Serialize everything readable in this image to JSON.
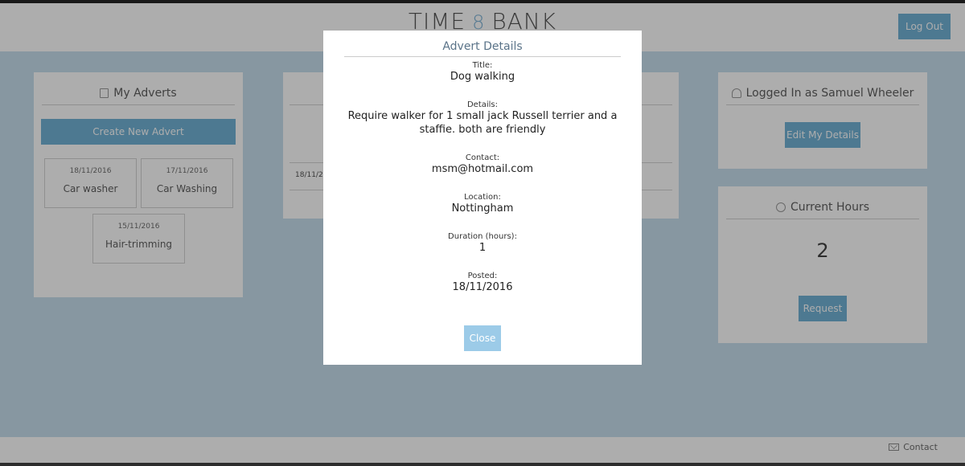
{
  "header": {
    "logo_left": "TIME",
    "logo_symbol": "8",
    "logo_right": "BANK",
    "logout_label": "Log Out"
  },
  "my_adverts": {
    "title": "My Adverts",
    "create_label": "Create New Advert",
    "items": [
      {
        "date": "18/11/2016",
        "name": "Car washer"
      },
      {
        "date": "17/11/2016",
        "name": "Car Washing"
      },
      {
        "date": "15/11/2016",
        "name": "Hair-trimming"
      }
    ]
  },
  "middle_panel": {
    "row_date": "18/11/20"
  },
  "user_panel": {
    "title": "Logged In as Samuel Wheeler",
    "edit_label": "Edit My Details"
  },
  "hours_panel": {
    "title": "Current Hours",
    "value": "2",
    "request_label": "Request"
  },
  "footer": {
    "contact_label": "Contact"
  },
  "modal": {
    "title": "Advert Details",
    "fields": [
      {
        "label": "Title:",
        "value": "Dog walking"
      },
      {
        "label": "Details:",
        "value": "Require walker for 1 small jack Russell terrier and a staffie. both are friendly"
      },
      {
        "label": "Contact:",
        "value": "msm@hotmail.com"
      },
      {
        "label": "Location:",
        "value": "Nottingham"
      },
      {
        "label": "Duration (hours):",
        "value": "1"
      },
      {
        "label": "Posted:",
        "value": "18/11/2016"
      }
    ],
    "close_label": "Close"
  },
  "colors": {
    "accent": "#5ba6cf",
    "background": "#bdd9ea"
  }
}
